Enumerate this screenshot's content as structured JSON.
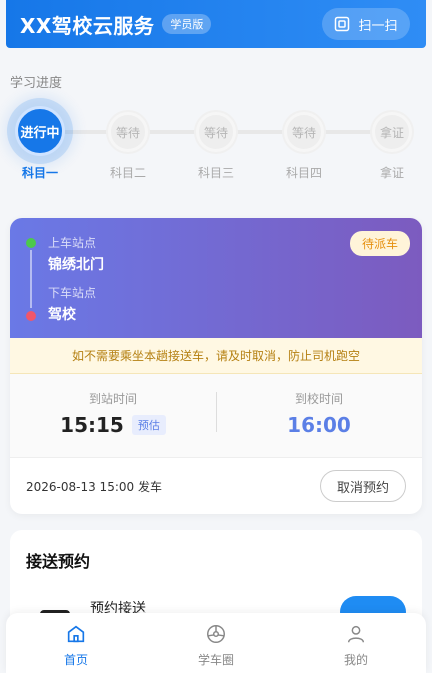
{
  "header": {
    "title": "XX驾校云服务",
    "badge": "学员版",
    "scan_label": "扫一扫"
  },
  "progress": {
    "section_label": "学习进度",
    "steps": [
      {
        "status": "进行中",
        "label": "科目一",
        "active": true
      },
      {
        "status": "等待",
        "label": "科目二",
        "active": false
      },
      {
        "status": "等待",
        "label": "科目三",
        "active": false
      },
      {
        "status": "等待",
        "label": "科目四",
        "active": false
      },
      {
        "status": "拿证",
        "label": "拿证",
        "active": false
      }
    ]
  },
  "shuttle": {
    "pickup_label": "上车站点",
    "pickup_name": "锦绣北门",
    "dropoff_label": "下车站点",
    "dropoff_name": "驾校",
    "status": "待派车",
    "notice": "如不需要乘坐本趟接送车，请及时取消，防止司机跑空",
    "arrive_station_label": "到站时间",
    "arrive_station_time": "15:15",
    "estimate_tag": "预估",
    "arrive_school_label": "到校时间",
    "arrive_school_time": "16:00",
    "depart_text": "2026-08-13 15:00 发车",
    "cancel_label": "取消预约"
  },
  "booking": {
    "title": "接送预约",
    "item_name": "预约接送"
  },
  "tabbar": {
    "items": [
      {
        "label": "首页",
        "icon": "home-icon",
        "active": true
      },
      {
        "label": "学车圈",
        "icon": "steering-wheel-icon",
        "active": false
      },
      {
        "label": "我的",
        "icon": "user-icon",
        "active": false
      }
    ]
  },
  "colors": {
    "primary": "#1677e8",
    "route_gradient_start": "#6a79e6",
    "route_gradient_end": "#7c5bbf",
    "status_orange": "#e6900f",
    "time_blue": "#5b7fe6"
  }
}
